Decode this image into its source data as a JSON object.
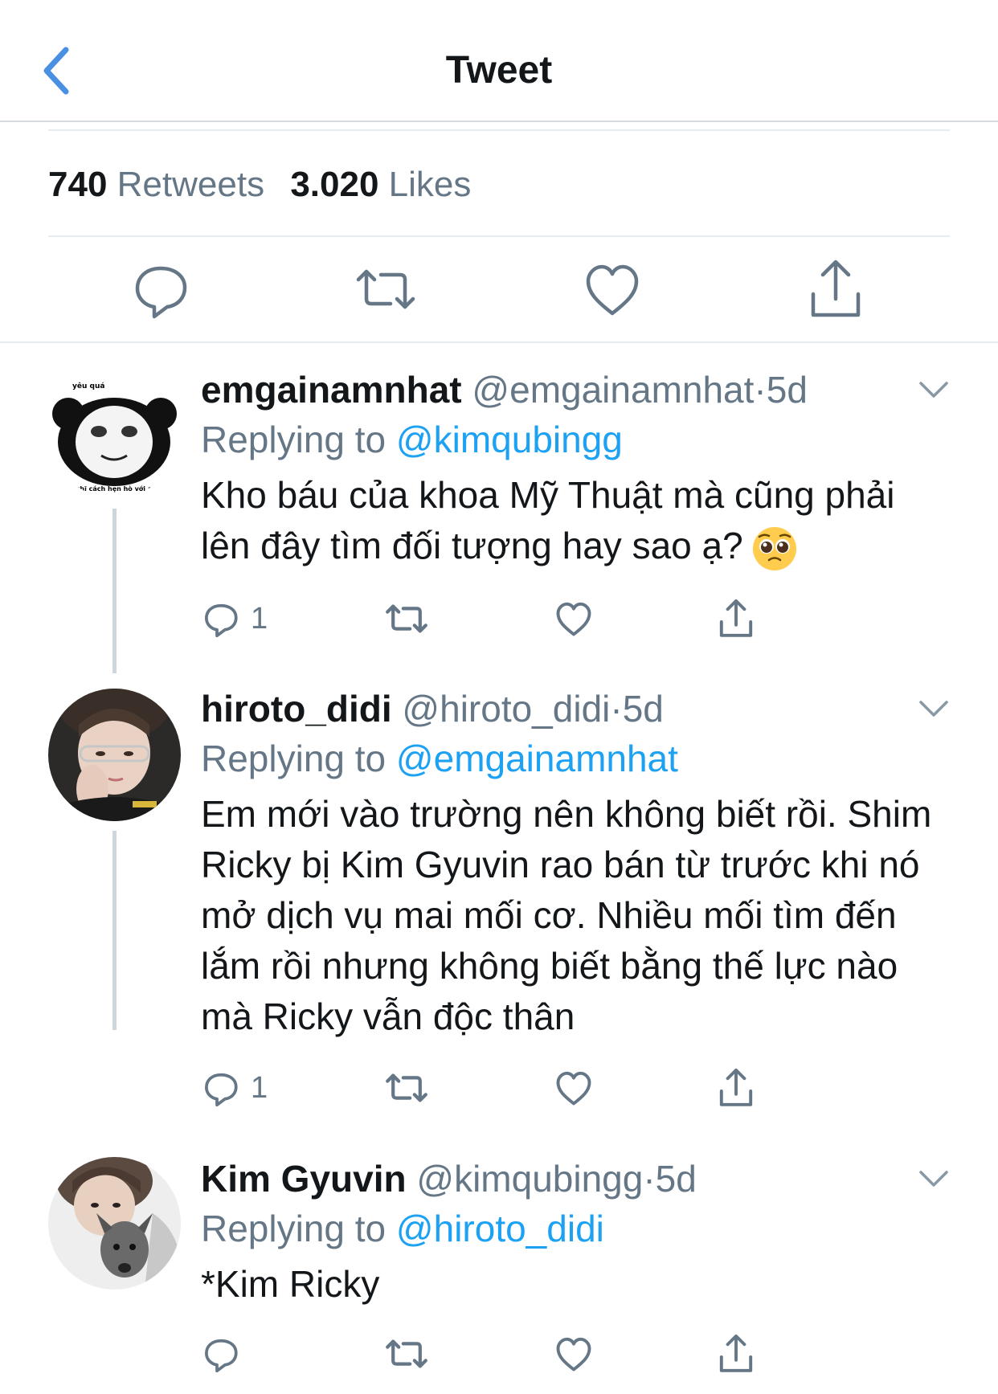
{
  "header": {
    "title": "Tweet"
  },
  "stats": {
    "retweets_count": "740",
    "retweets_label": "Retweets",
    "likes_count": "3.020",
    "likes_label": "Likes"
  },
  "replies": [
    {
      "name": "emgainamnhat",
      "handle": "@emgainamnhat",
      "dot": "·",
      "time": "5d",
      "replying_prefix": "Replying to",
      "replying_to": "@kimqubingg",
      "text": "Kho báu của khoa Mỹ Thuật mà cũng phải lên đây tìm đối tượng hay sao ạ?",
      "emoji": "pleading-face-emoji",
      "reply_count": "1",
      "avatar_caption_top": "yêu quá",
      "avatar_caption_bottom": "nghĩ cách hẹn hò với ai"
    },
    {
      "name": "hiroto_didi",
      "handle": "@hiroto_didi",
      "dot": "·",
      "time": "5d",
      "replying_prefix": "Replying to",
      "replying_to": "@emgainamnhat",
      "text": "Em mới vào trường nên không biết rồi. Shim Ricky bị Kim Gyuvin rao bán từ trước khi nó mở dịch vụ mai mối cơ. Nhiều mối tìm đến lắm rồi nhưng không biết bằng thế lực nào mà Ricky vẫn độc thân",
      "reply_count": "1"
    },
    {
      "name": "Kim Gyuvin",
      "handle": "@kimqubingg",
      "dot": "·",
      "time": "5d",
      "replying_prefix": "Replying to",
      "replying_to": "@hiroto_didi",
      "text": "*Kim Ricky",
      "reply_count": ""
    }
  ],
  "icons": {
    "back": "chevron-left-icon",
    "reply": "speech-bubble-icon",
    "retweet": "retweet-icon",
    "like": "heart-icon",
    "share": "share-icon",
    "more": "chevron-down-icon"
  },
  "colors": {
    "accent": "#1da1f2",
    "icon": "#657786",
    "text": "#14171a",
    "secondary": "#657786",
    "divider": "#e6ecf0",
    "thread": "#ccd6dd",
    "back": "#4a90e2"
  }
}
